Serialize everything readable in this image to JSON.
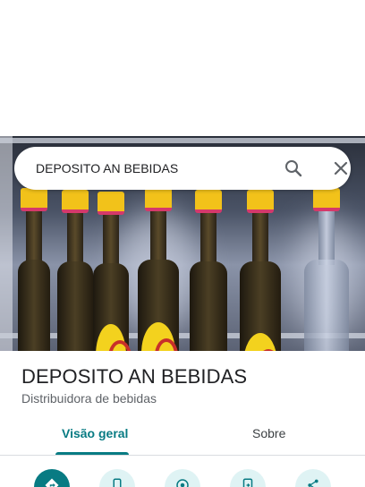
{
  "search": {
    "value": "DEPOSITO AN BEBIDAS",
    "search_icon": "search-icon",
    "close_icon": "close-icon"
  },
  "place": {
    "name": "DEPOSITO AN BEBIDAS",
    "category": "Distribuidora de bebidas"
  },
  "tabs": [
    {
      "label": "Visão geral",
      "selected": true
    },
    {
      "label": "Sobre",
      "selected": false
    }
  ],
  "actions": [
    {
      "icon": "directions-icon"
    },
    {
      "icon": "phone-icon"
    },
    {
      "icon": "nearby-icon"
    },
    {
      "icon": "send-to-phone-icon"
    },
    {
      "icon": "share-icon"
    }
  ],
  "colors": {
    "accent": "#087b83",
    "action_bg": "#dff3f4",
    "title_text": "#202124",
    "secondary_text": "#5f6368"
  }
}
